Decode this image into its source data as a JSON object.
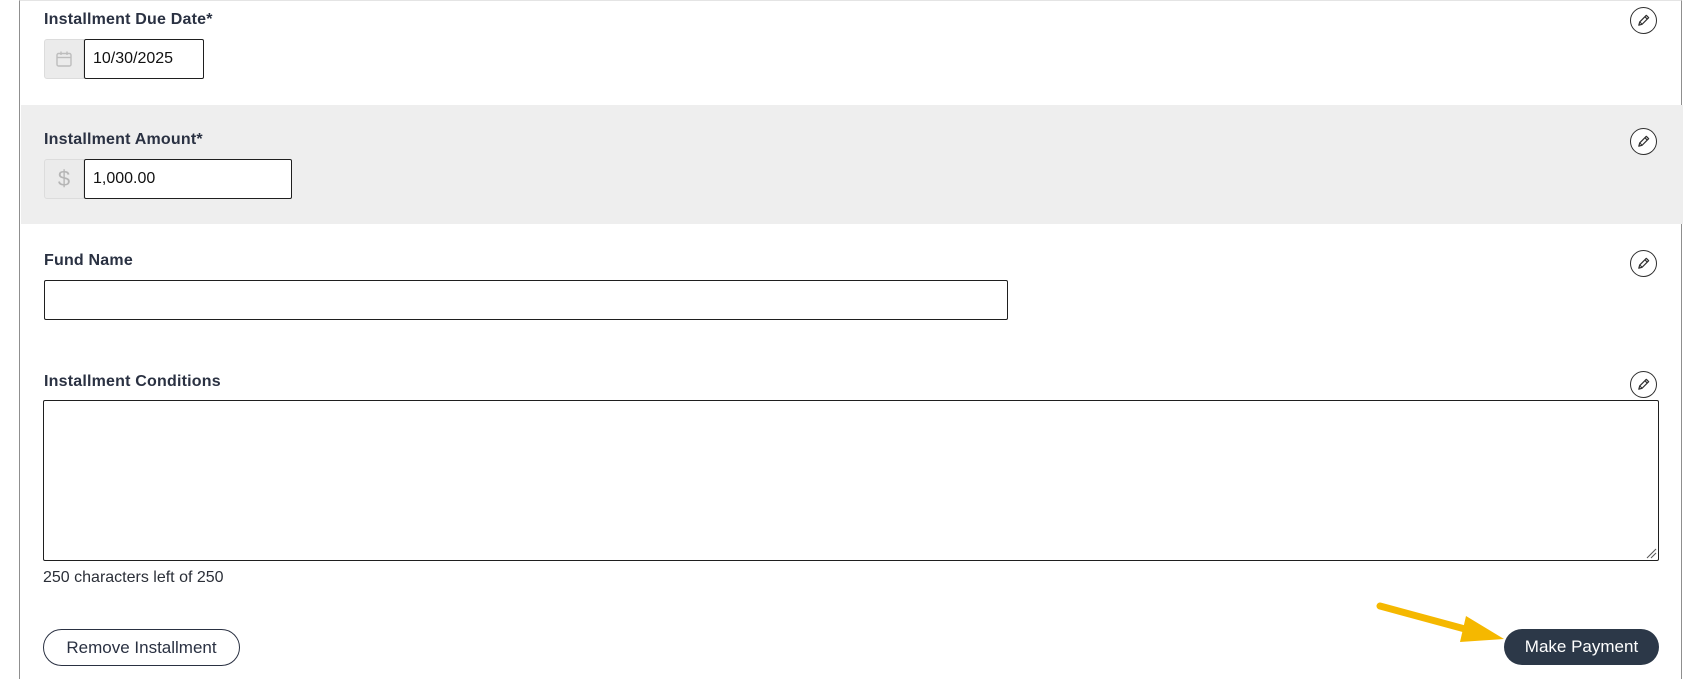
{
  "fields": {
    "due_date": {
      "label": "Installment Due Date*",
      "value": "10/30/2025",
      "addon_icon": "calendar-icon",
      "edit_icon": "pencil-icon"
    },
    "amount": {
      "label": "Installment Amount*",
      "value": "1,000.00",
      "addon_symbol": "$",
      "edit_icon": "pencil-icon"
    },
    "fund_name": {
      "label": "Fund Name",
      "value": "",
      "edit_icon": "pencil-icon"
    },
    "conditions": {
      "label": "Installment Conditions",
      "value": "",
      "edit_icon": "pencil-icon",
      "counter_text": "250 characters left of 250"
    }
  },
  "actions": {
    "remove_label": "Remove Installment",
    "pay_label": "Make Payment"
  },
  "annotation": {
    "arrow_color": "#F5B800"
  },
  "colors": {
    "shaded_row": "#EEEEEE",
    "primary_button": "#2C3848"
  }
}
